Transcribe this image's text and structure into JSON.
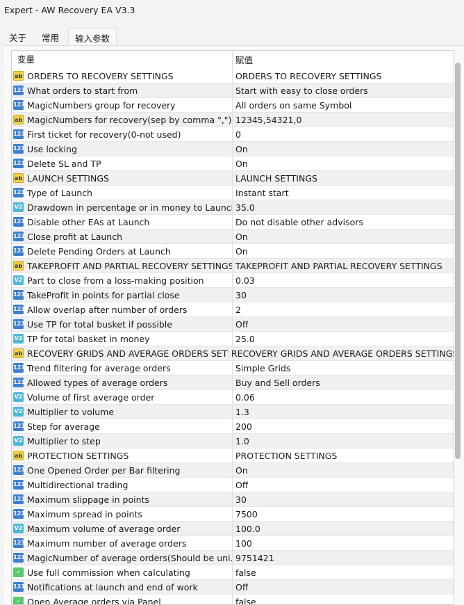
{
  "window": {
    "title": "Expert - AW Recovery EA V3.3"
  },
  "tabs": [
    {
      "label": "关于"
    },
    {
      "label": "常用"
    },
    {
      "label": "输入参数"
    }
  ],
  "columns": {
    "variable": "变量",
    "value": "赋值"
  },
  "rows": [
    {
      "icon": "ab",
      "name": "ORDERS TO RECOVERY SETTINGS",
      "value": "ORDERS TO RECOVERY SETTINGS"
    },
    {
      "icon": "int",
      "name": "What orders to start from",
      "value": "Start with easy to close orders"
    },
    {
      "icon": "int",
      "name": "MagicNumbers group for recovery",
      "value": "All orders on same Symbol"
    },
    {
      "icon": "ab",
      "name": "MagicNumbers for recovery(sep by comma \",\")",
      "value": "12345,54321,0"
    },
    {
      "icon": "int",
      "name": "First ticket for recovery(0-not used)",
      "value": "0"
    },
    {
      "icon": "int",
      "name": "Use locking",
      "value": "On"
    },
    {
      "icon": "int",
      "name": "Delete SL and TP",
      "value": "On"
    },
    {
      "icon": "ab",
      "name": "LAUNCH SETTINGS",
      "value": "LAUNCH SETTINGS"
    },
    {
      "icon": "int",
      "name": "Type of Launch",
      "value": "Instant start"
    },
    {
      "icon": "dbl",
      "name": "Drawdown in percentage or in money to Launch",
      "value": "35.0"
    },
    {
      "icon": "int",
      "name": "Disable other EAs at Launch",
      "value": "Do not disable other advisors"
    },
    {
      "icon": "int",
      "name": "Close profit at Launch",
      "value": "On"
    },
    {
      "icon": "int",
      "name": "Delete Pending Orders at Launch",
      "value": "On"
    },
    {
      "icon": "ab",
      "name": "TAKEPROFIT AND PARTIAL RECOVERY SETTINGS",
      "value": "TAKEPROFIT AND PARTIAL RECOVERY SETTINGS"
    },
    {
      "icon": "dbl",
      "name": "Part to close from a loss-making position",
      "value": "0.03"
    },
    {
      "icon": "int",
      "name": "TakeProfit in points for partial close",
      "value": "30"
    },
    {
      "icon": "int",
      "name": "Allow overlap after number of orders",
      "value": "2"
    },
    {
      "icon": "int",
      "name": "Use TP for total busket if possible",
      "value": "Off"
    },
    {
      "icon": "dbl",
      "name": "TP for total basket in money",
      "value": "25.0"
    },
    {
      "icon": "ab",
      "name": "RECOVERY GRIDS AND AVERAGE ORDERS SETTI...",
      "value": "RECOVERY GRIDS AND AVERAGE ORDERS SETTINGS"
    },
    {
      "icon": "int",
      "name": "Trend filtering for average orders",
      "value": "Simple Grids"
    },
    {
      "icon": "int",
      "name": "Allowed types of average orders",
      "value": "Buy and Sell orders"
    },
    {
      "icon": "dbl",
      "name": "Volume of first average order",
      "value": "0.06"
    },
    {
      "icon": "dbl",
      "name": "Multiplier to volume",
      "value": "1.3"
    },
    {
      "icon": "int",
      "name": "Step for average",
      "value": "200"
    },
    {
      "icon": "dbl",
      "name": "Multiplier to step",
      "value": "1.0"
    },
    {
      "icon": "ab",
      "name": "PROTECTION SETTINGS",
      "value": "PROTECTION SETTINGS"
    },
    {
      "icon": "int",
      "name": "One Opened Order per Bar filtering",
      "value": "On"
    },
    {
      "icon": "int",
      "name": "Multidirectional trading",
      "value": "Off"
    },
    {
      "icon": "int",
      "name": "Maximum slippage in points",
      "value": "30"
    },
    {
      "icon": "int",
      "name": "Maximum spread in points",
      "value": "7500"
    },
    {
      "icon": "dbl",
      "name": "Maximum volume of average order",
      "value": "100.0"
    },
    {
      "icon": "int",
      "name": "Maximum number of average orders",
      "value": "100"
    },
    {
      "icon": "int",
      "name": "MagicNumber of average orders(Should be uni...",
      "value": "9751421"
    },
    {
      "icon": "bool",
      "name": "Use full commission when calculating",
      "value": "false"
    },
    {
      "icon": "int",
      "name": "Notifications at launch and end of work",
      "value": "Off"
    },
    {
      "icon": "bool",
      "name": "Open Average orders via Panel",
      "value": "false"
    }
  ]
}
